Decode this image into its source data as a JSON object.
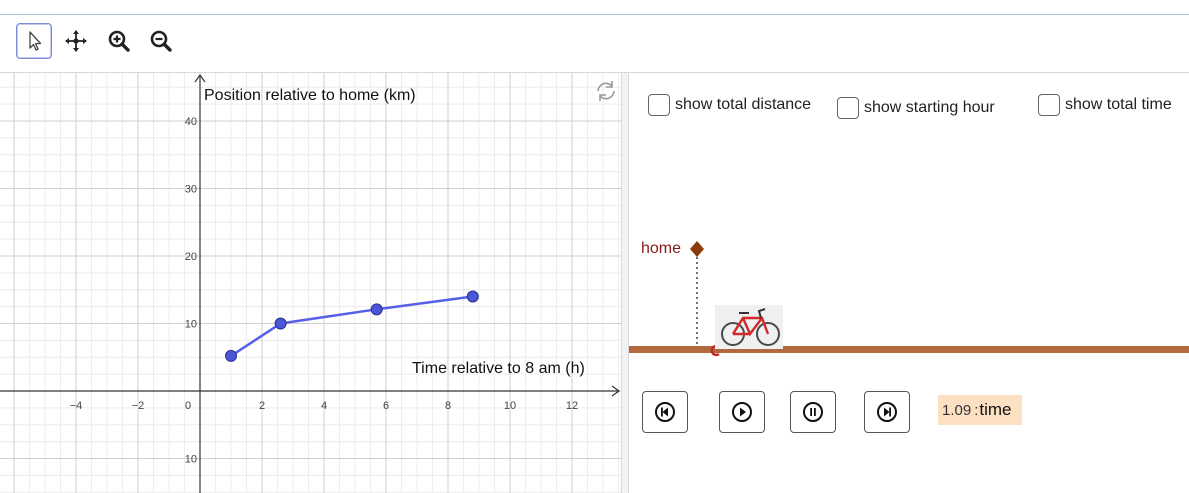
{
  "toolbar": {
    "tools": [
      {
        "name": "move",
        "icon": "arrow-cursor-icon",
        "selected": true
      },
      {
        "name": "move-graphics-view",
        "icon": "four-way-arrow-icon",
        "selected": false
      },
      {
        "name": "zoom-in",
        "icon": "zoom-in-icon",
        "selected": false
      },
      {
        "name": "zoom-out",
        "icon": "zoom-out-icon",
        "selected": false
      }
    ]
  },
  "graph": {
    "y_axis_label": "Position relative to home (km)",
    "x_axis_label": "Time relative to 8 am (h)",
    "x_ticks": [
      "−4",
      "−2",
      "0",
      "2",
      "4",
      "6",
      "8",
      "10",
      "12"
    ],
    "y_ticks": [
      "40",
      "30",
      "20",
      "10",
      "10"
    ],
    "reset_icon": "refresh-icon",
    "line_color": "#5560e8",
    "point_color": "#4a56d8"
  },
  "chart_data": {
    "type": "line",
    "x": [
      1.0,
      2.6,
      5.7,
      8.8
    ],
    "y": [
      5.2,
      10.0,
      12.1,
      14.0
    ],
    "xlabel": "Time relative to 8 am (h)",
    "ylabel": "Position relative to home (km)",
    "xlim": [
      -6.3,
      13.9
    ],
    "ylim": [
      -12,
      46
    ],
    "grid": true
  },
  "panel": {
    "checkboxes": [
      {
        "label": "show total distance",
        "checked": false
      },
      {
        "label": "show starting hour",
        "checked": false
      },
      {
        "label": "show total time",
        "checked": false
      }
    ],
    "home_label": "home",
    "home_color": "#8b1a1a",
    "road_color": "#b3683f",
    "controls": [
      {
        "name": "rewind",
        "icon": "rewind-icon"
      },
      {
        "name": "play",
        "icon": "play-icon"
      },
      {
        "name": "pause",
        "icon": "pause-icon"
      },
      {
        "name": "fast-forward",
        "icon": "fast-forward-icon"
      }
    ],
    "time_value": "1.09",
    "time_separator": ":",
    "time_label": "time"
  }
}
